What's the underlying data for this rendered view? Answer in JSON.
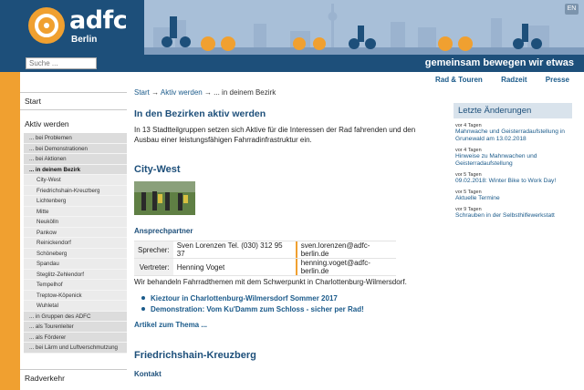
{
  "header": {
    "logo_text": "adfc",
    "logo_sub": "Berlin",
    "search_placeholder": "Suche ...",
    "slogan": "gemeinsam bewegen wir etwas",
    "lang": "EN"
  },
  "toplinks": [
    "Rad & Touren",
    "Radzeit",
    "Presse"
  ],
  "sidebar": {
    "start": "Start",
    "aktiv": "Aktiv werden",
    "items": [
      {
        "label": "... bei Problemen",
        "level": 1
      },
      {
        "label": "... bei Demonstrationen",
        "level": 1
      },
      {
        "label": "... bei Aktionen",
        "level": 1
      },
      {
        "label": "... in deinem Bezirk",
        "level": 1,
        "active": true
      },
      {
        "label": "City-West",
        "level": 2
      },
      {
        "label": "Friedrichshain-Kreuzberg",
        "level": 2
      },
      {
        "label": "Lichtenberg",
        "level": 2
      },
      {
        "label": "Mitte",
        "level": 2
      },
      {
        "label": "Neukölln",
        "level": 2
      },
      {
        "label": "Pankow",
        "level": 2
      },
      {
        "label": "Reinickendorf",
        "level": 2
      },
      {
        "label": "Schöneberg",
        "level": 2
      },
      {
        "label": "Spandau",
        "level": 2
      },
      {
        "label": "Steglitz-Zehlendorf",
        "level": 2
      },
      {
        "label": "Tempelhof",
        "level": 2
      },
      {
        "label": "Treptow-Köpenick",
        "level": 2
      },
      {
        "label": "Wuhletal",
        "level": 2
      },
      {
        "label": "... in Gruppen des ADFC",
        "level": 1
      },
      {
        "label": "... als Tourenleiter",
        "level": 1
      },
      {
        "label": "... als Förderer",
        "level": 1
      },
      {
        "label": "... bei Lärm und Luftverschmutzung",
        "level": 1
      }
    ],
    "radverkehr": "Radverkehr"
  },
  "main": {
    "breadcrumb": {
      "start": "Start",
      "arrow1": " → ",
      "aktiv": "Aktiv werden",
      "rest": " → ... in deinem Bezirk"
    },
    "title": "In den Bezirken aktiv werden",
    "intro": "In 13 Stadtteilgruppen setzen sich Aktive für die Interessen der Rad fahrenden und den Ausbau einer leistungsfähigen Fahrradinfrastruktur ein.",
    "section1": "City-West",
    "contact_head": "Ansprechpartner",
    "contacts": [
      {
        "role": "Sprecher:",
        "name": "Sven Lorenzen Tel. (030) 312 95 37",
        "email": "sven.lorenzen@adfc-berlin.de"
      },
      {
        "role": "Vertreter:",
        "name": "Henning Voget",
        "email": "henning.voget@adfc-berlin.de"
      }
    ],
    "topic_text": "Wir behandeln Fahrradthemen mit dem Schwerpunkt in Charlottenburg-Wilmersdorf.",
    "bullets": [
      "Kieztour in Charlottenburg-Wilmersdorf Sommer 2017",
      "Demonstration: Vom Ku'Damm zum Schloss - sicher per Rad!"
    ],
    "more": "Artikel zum Thema ...",
    "section2": "Friedrichshain-Kreuzberg",
    "kontakt": "Kontakt"
  },
  "right": {
    "title": "Letzte Änderungen",
    "items": [
      {
        "age": "vor 4 Tagen",
        "text": "Mahnwache und Geisterradaufstellung in Grunewald am 13.02.2018"
      },
      {
        "age": "vor 4 Tagen",
        "text": "Hinweise zu Mahnwachen und Geisterradaufstellung"
      },
      {
        "age": "vor 5 Tagen",
        "text": "09.02.2018: Winter Bike to Work Day!"
      },
      {
        "age": "vor 5 Tagen",
        "text": "Aktuelle Termine"
      },
      {
        "age": "vor 9 Tagen",
        "text": "Schrauben in der Selbsthilfewerkstatt"
      }
    ]
  }
}
